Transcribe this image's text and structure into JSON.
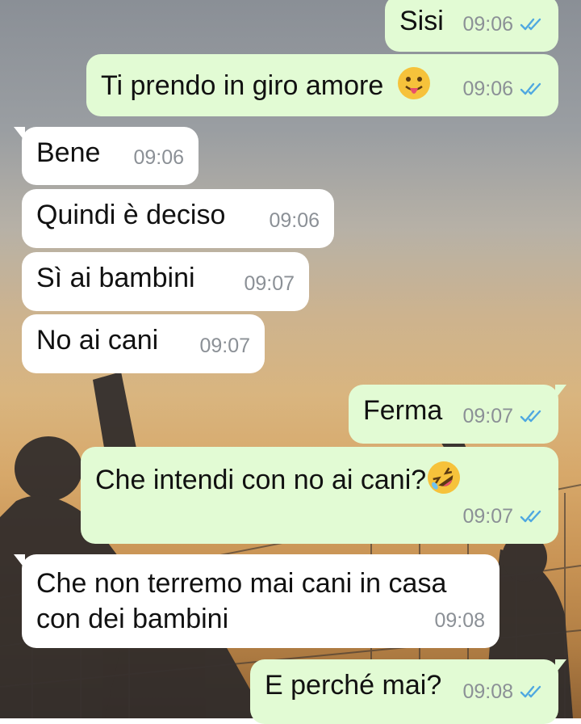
{
  "chat": {
    "messages": [
      {
        "text": "Sisi",
        "time": "09:06",
        "direction": "outgoing",
        "status": "read"
      },
      {
        "text": "Ti prendo in giro amore",
        "emoji": "face-with-tongue-emoji",
        "time": "09:06",
        "direction": "outgoing",
        "status": "read"
      },
      {
        "text": "Bene",
        "time": "09:06",
        "direction": "incoming"
      },
      {
        "text": "Quindi è deciso",
        "time": "09:06",
        "direction": "incoming"
      },
      {
        "text": "Sì ai bambini",
        "time": "09:07",
        "direction": "incoming"
      },
      {
        "text": "No ai cani",
        "time": "09:07",
        "direction": "incoming"
      },
      {
        "text": "Ferma",
        "time": "09:07",
        "direction": "outgoing",
        "status": "read"
      },
      {
        "text": "Che intendi con no ai cani?",
        "emoji": "rolling-on-floor-laughing-emoji",
        "time": "09:07",
        "direction": "outgoing",
        "status": "read"
      },
      {
        "line1": "Che non terremo mai cani in casa",
        "line2": "con dei bambini",
        "time": "09:08",
        "direction": "incoming"
      },
      {
        "text": "E perché mai?",
        "time": "09:08",
        "direction": "outgoing",
        "status": "read"
      }
    ]
  },
  "colors": {
    "outgoing_bubble": "#e2fbd4",
    "incoming_bubble": "#ffffff",
    "read_ticks": "#4fa8e0",
    "timestamp": "#8b9096"
  }
}
